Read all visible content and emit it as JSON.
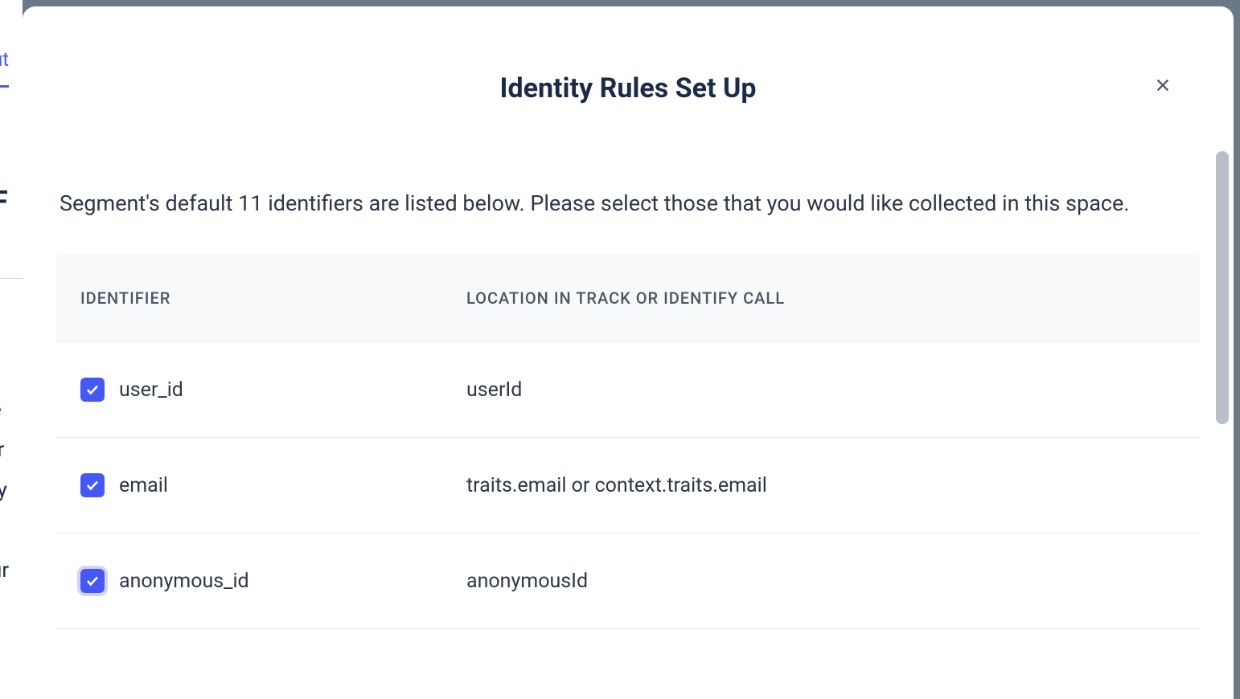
{
  "background": {
    "tab_text": "ut",
    "heading_fragment": "F",
    "text_1": "e",
    "text_2": "tr",
    "text_3": "ty",
    "text_4": "ur"
  },
  "modal": {
    "title": "Identity Rules Set Up",
    "description": "Segment's default 11 identifiers are listed below. Please select those that you would like collected in this space.",
    "table": {
      "header_identifier": "IDENTIFIER",
      "header_location": "LOCATION IN TRACK OR IDENTIFY CALL",
      "rows": [
        {
          "checked": true,
          "focused": false,
          "identifier": "user_id",
          "location": "userId"
        },
        {
          "checked": true,
          "focused": false,
          "identifier": "email",
          "location": "traits.email or context.traits.email"
        },
        {
          "checked": true,
          "focused": true,
          "identifier": "anonymous_id",
          "location": "anonymousId"
        }
      ]
    }
  }
}
